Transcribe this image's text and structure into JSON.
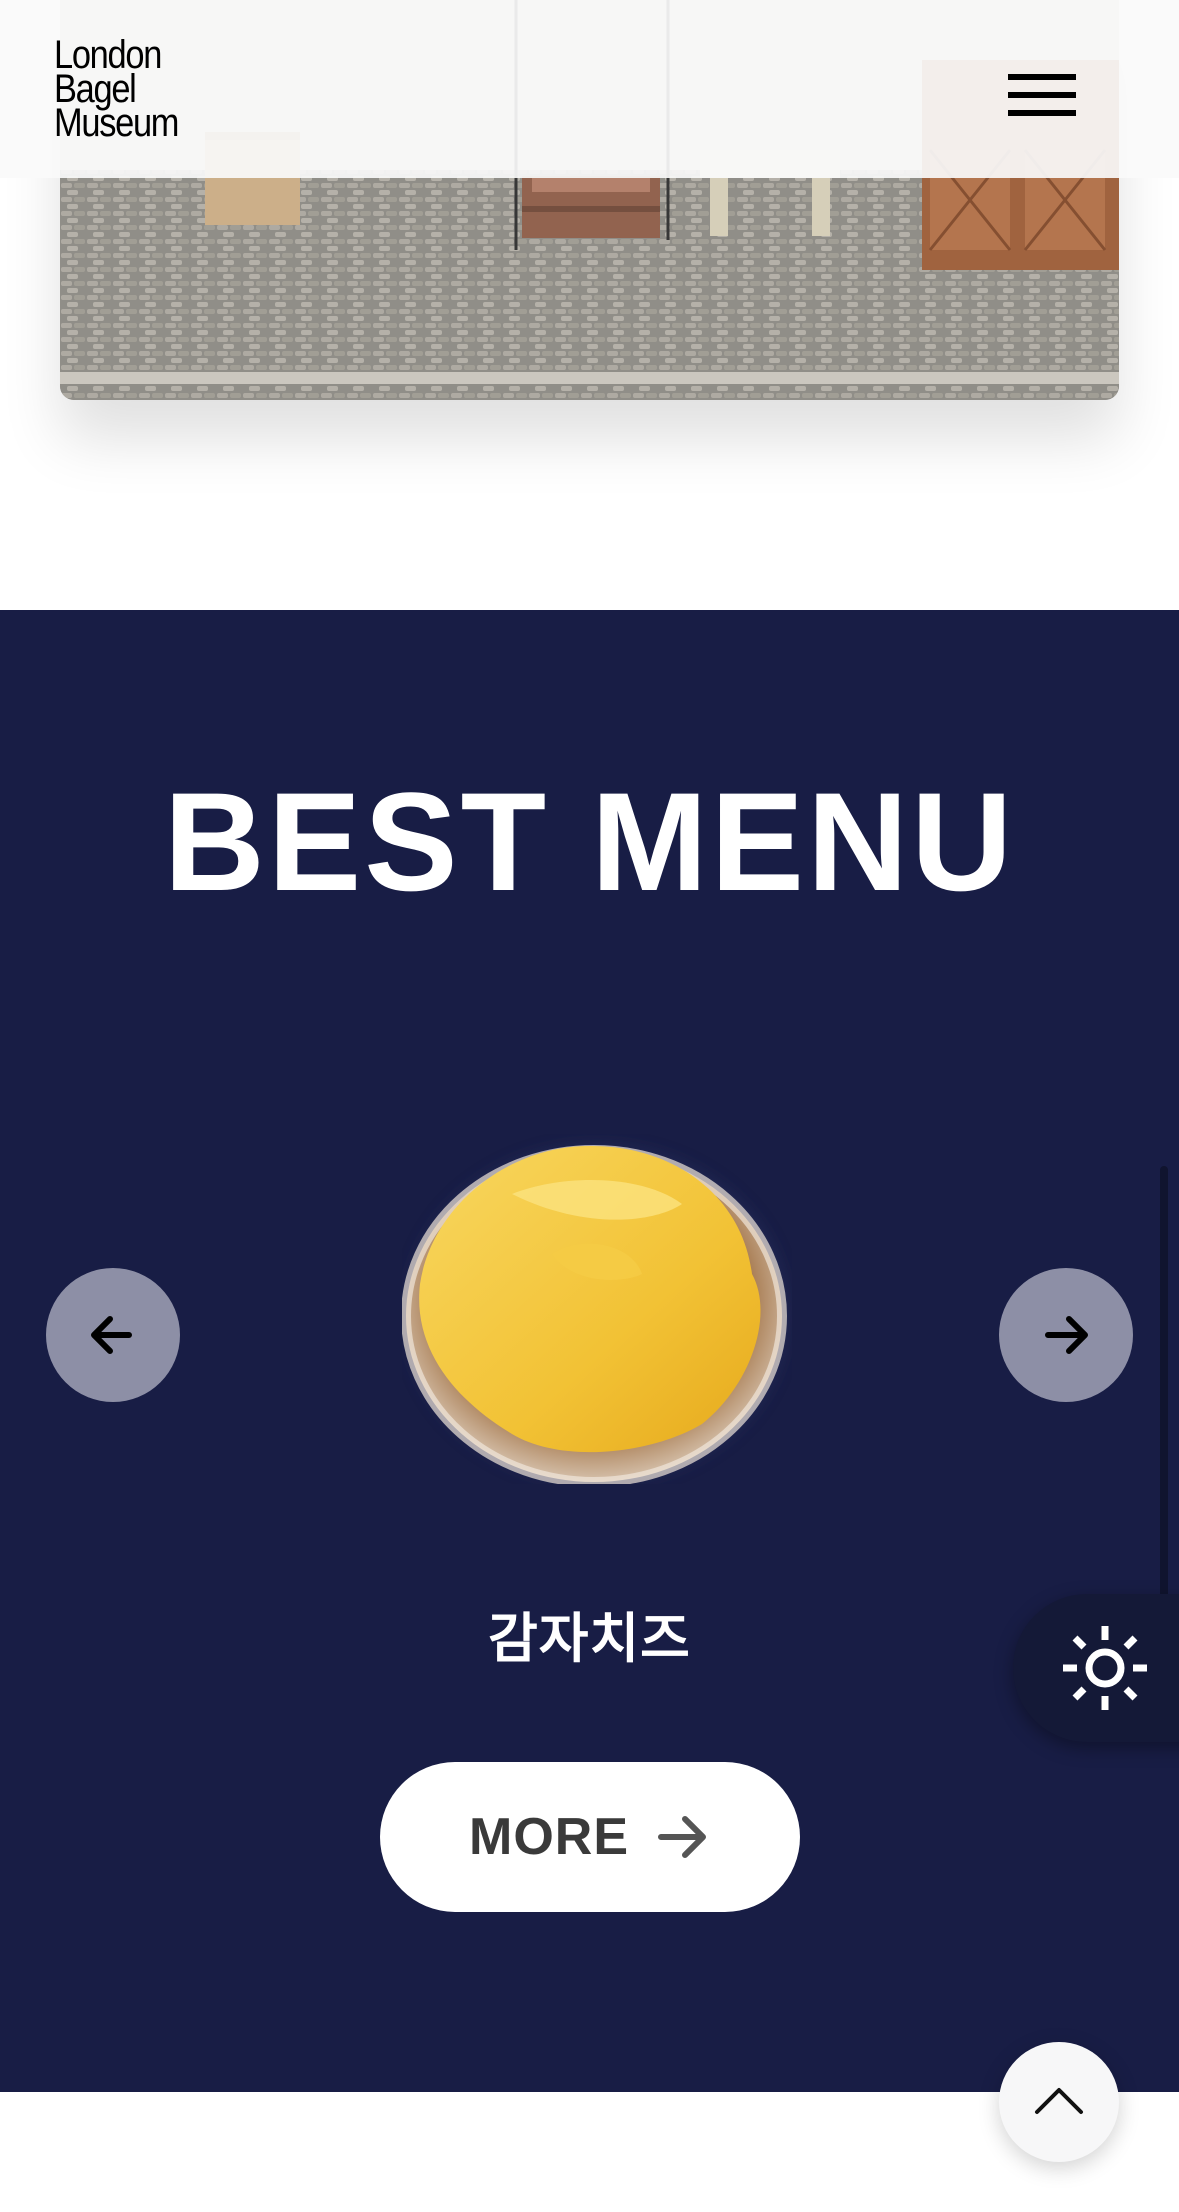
{
  "header": {
    "logo_lines": [
      "London",
      "Bagel",
      "Museum"
    ]
  },
  "icons": {
    "menu": "hamburger-menu-icon",
    "prev": "arrow-left-icon",
    "next": "arrow-right-icon",
    "more": "arrow-right-icon",
    "theme": "sun-icon",
    "scroll_top": "chevron-up-icon"
  },
  "best_menu": {
    "title": "BEST MENU",
    "product_name": "감자치즈",
    "more_label": "MORE"
  },
  "colors": {
    "section_bg": "#181d45",
    "arrow_bg": "#8d8fa6",
    "header_bg": "#fafafa",
    "button_bg": "#ffffff",
    "more_text": "#3a3a3a"
  }
}
